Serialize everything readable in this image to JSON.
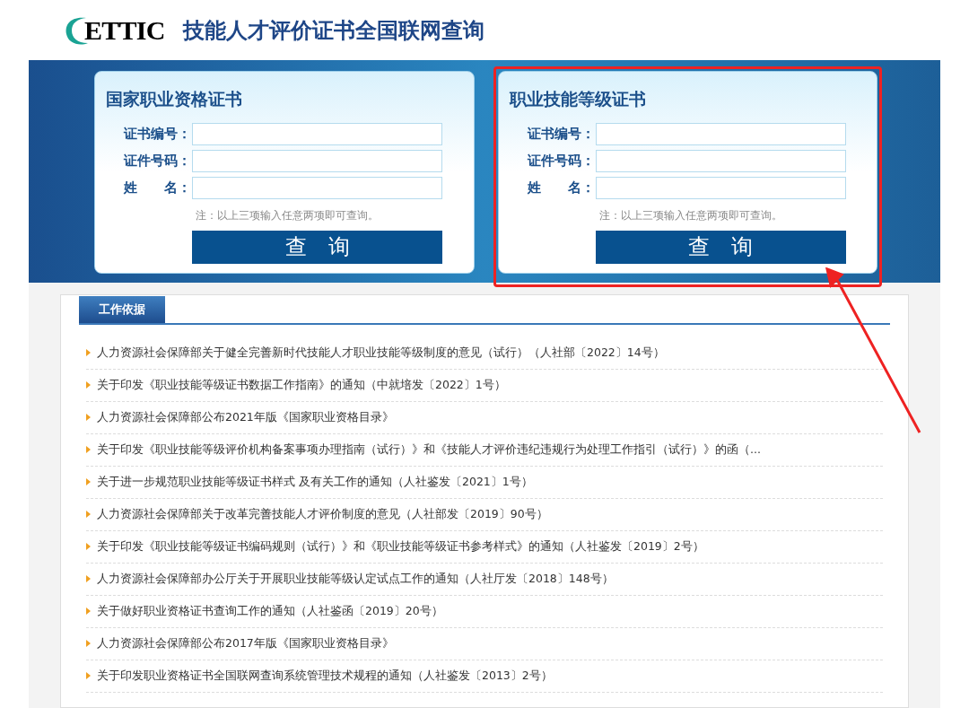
{
  "header": {
    "logo_text": "ETTIC",
    "title": "技能人才评价证书全国联网查询"
  },
  "query_cards": [
    {
      "title": "国家职业资格证书",
      "fields": [
        {
          "label": "证书编号："
        },
        {
          "label": "证件号码："
        },
        {
          "label": "姓　　名："
        }
      ],
      "note": "注：以上三项输入任意两项即可查询。",
      "button": "查　询",
      "highlighted": false
    },
    {
      "title": "职业技能等级证书",
      "fields": [
        {
          "label": "证书编号："
        },
        {
          "label": "证件号码："
        },
        {
          "label": "姓　　名："
        }
      ],
      "note": "注：以上三项输入任意两项即可查询。",
      "button": "查　询",
      "highlighted": true
    }
  ],
  "section": {
    "tab": "工作依据",
    "items": [
      "人力资源社会保障部关于健全完善新时代技能人才职业技能等级制度的意见（试行）（人社部〔2022〕14号）",
      "关于印发《职业技能等级证书数据工作指南》的通知（中就培发〔2022〕1号）",
      "人力资源社会保障部公布2021年版《国家职业资格目录》",
      "关于印发《职业技能等级评价机构备案事项办理指南（试行）》和《技能人才评价违纪违规行为处理工作指引（试行）》的函（...",
      "关于进一步规范职业技能等级证书样式 及有关工作的通知（人社鉴发〔2021〕1号）",
      "人力资源社会保障部关于改革完善技能人才评价制度的意见（人社部发〔2019〕90号）",
      "关于印发《职业技能等级证书编码规则（试行）》和《职业技能等级证书参考样式》的通知（人社鉴发〔2019〕2号）",
      "人力资源社会保障部办公厅关于开展职业技能等级认定试点工作的通知（人社厅发〔2018〕148号）",
      "关于做好职业资格证书查询工作的通知（人社鉴函〔2019〕20号）",
      "人力资源社会保障部公布2017年版《国家职业资格目录》",
      "关于印发职业资格证书全国联网查询系统管理技术规程的通知（人社鉴发〔2013〕2号）"
    ]
  }
}
